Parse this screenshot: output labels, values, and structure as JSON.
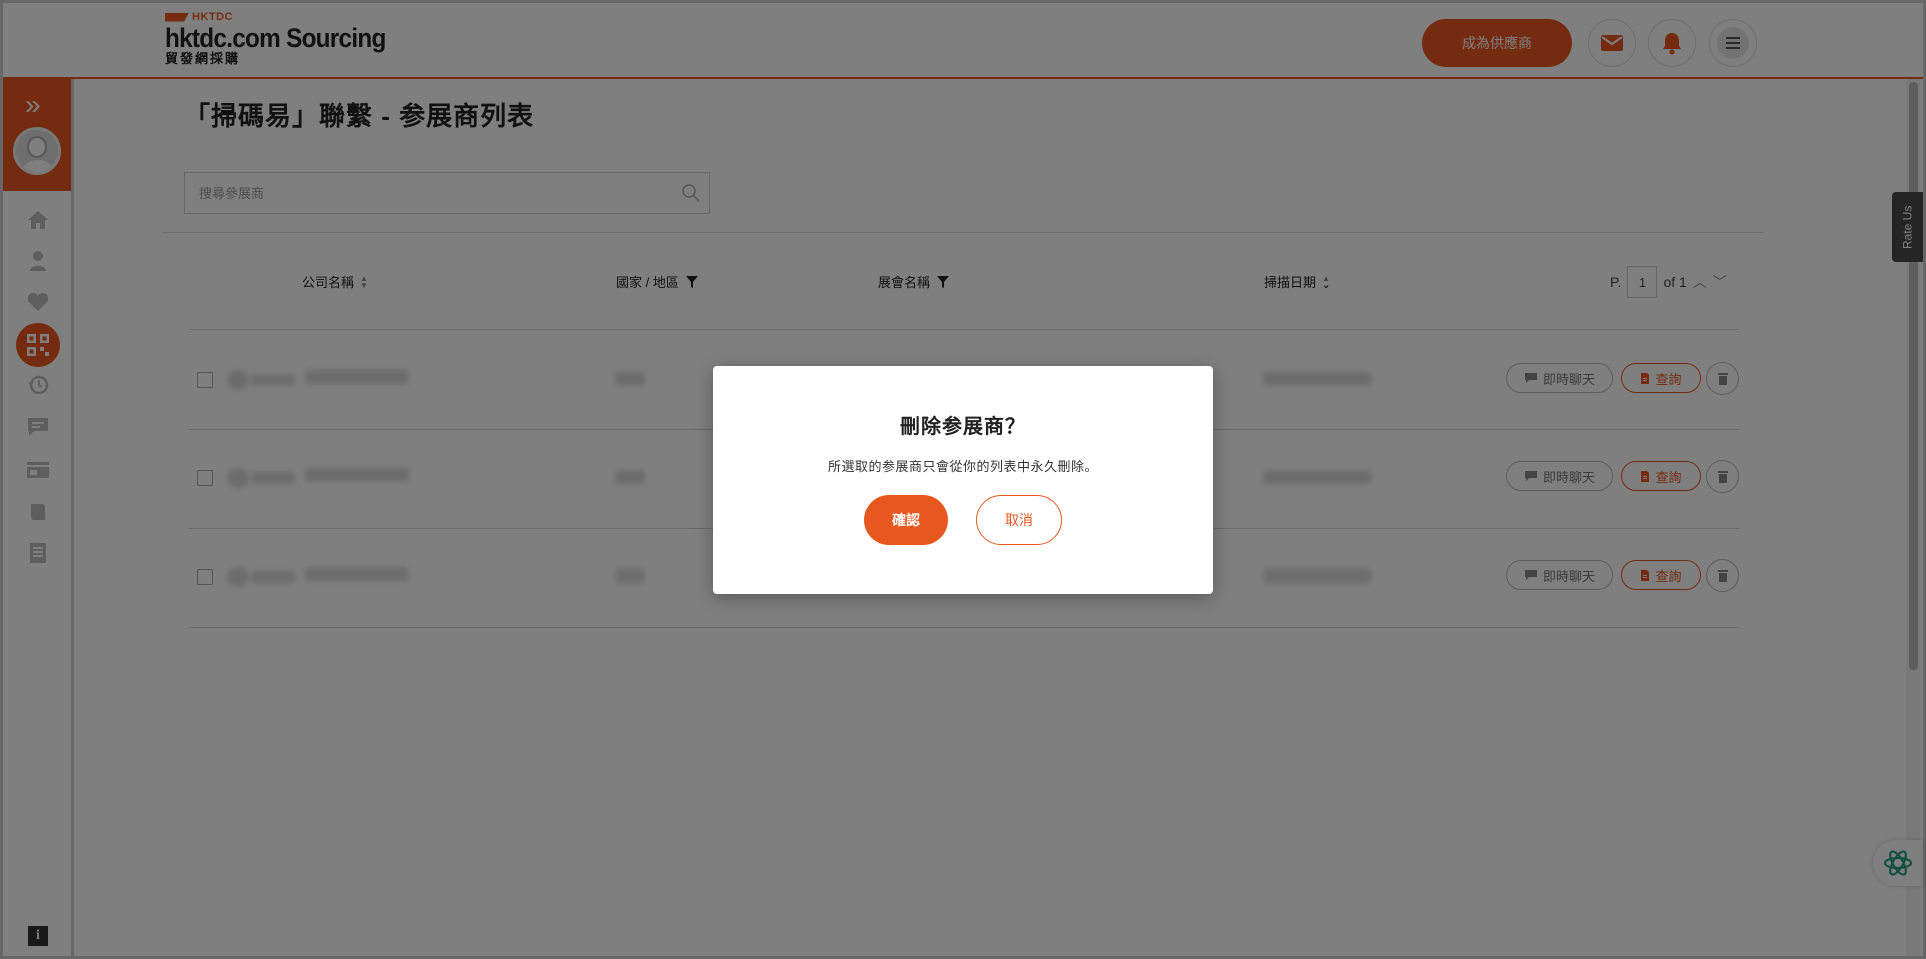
{
  "brand": {
    "logo_tag": "HKTDC",
    "logo_main": "hktdc.com Sourcing",
    "logo_sub": "貿發網採購",
    "accent_color": "#e8571e"
  },
  "header": {
    "supplier_button": "成為供應商",
    "icons": [
      "mail-icon",
      "bell-icon",
      "menu-icon"
    ]
  },
  "sidebar": {
    "icons": [
      "home-icon",
      "person-icon",
      "heart-icon",
      "qr-code-icon",
      "history-icon",
      "chat-icon",
      "card-icon",
      "book-icon",
      "document-icon"
    ],
    "active": "qr-code-icon",
    "info_label": "i"
  },
  "page": {
    "title": "「掃碼易」聯繫 - 参展商列表"
  },
  "search": {
    "placeholder": "搜尋參展商",
    "value": ""
  },
  "table": {
    "columns": {
      "company": "公司名稱",
      "country": "國家 / 地區",
      "show": "展會名稱",
      "scan_date": "掃描日期"
    },
    "pagination": {
      "prefix": "P.",
      "page": "1",
      "of_label": "of 1"
    },
    "rows": [
      {
        "chat_label": "即時聊天",
        "enquiry_label": "查詢"
      },
      {
        "chat_label": "即時聊天",
        "enquiry_label": "查詢"
      },
      {
        "chat_label": "即時聊天",
        "enquiry_label": "查詢"
      }
    ]
  },
  "rate_us": "Rate Us",
  "modal": {
    "title": "刪除参展商？",
    "message": "所選取的参展商只會從你的列表中永久刪除。",
    "confirm_label": "確認",
    "cancel_label": "取消"
  }
}
